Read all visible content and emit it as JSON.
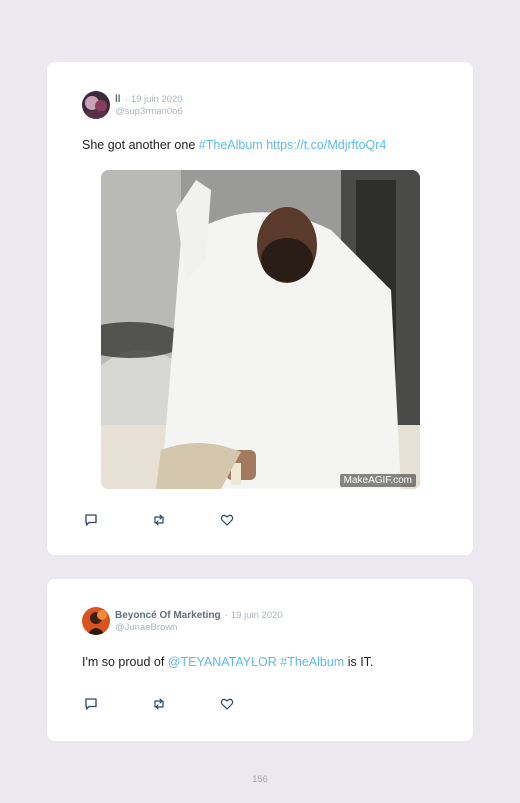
{
  "tweets": [
    {
      "author": "ll",
      "date": "19 juin 2020",
      "handle": "@sup3rmari0o6",
      "text_plain": "She got another one",
      "hashtag": "#TheAlbum",
      "url": "https://t.co/MdjrftoQr4",
      "media_watermark": "MakeAGIF.com",
      "avatar_icon": "user-avatar-photo",
      "actions": [
        "reply-icon",
        "retweet-icon",
        "like-icon"
      ]
    },
    {
      "author": "Beyoncé Of Marketing",
      "date": "19 juin 2020",
      "handle": "@JunaeBrown",
      "text_plain": "I'm so proud of",
      "mention": "@TEYANATAYLOR",
      "hashtag": "#TheAlbum",
      "text_end": "is IT.",
      "avatar_icon": "user-avatar-photo",
      "actions": [
        "reply-icon",
        "retweet-icon",
        "like-icon"
      ]
    }
  ],
  "page": {
    "number": "156"
  },
  "colors": {
    "link": "#5dbbe8",
    "name": "#5e6f80",
    "muted": "#a9b4bf",
    "background": "#ece8f0"
  }
}
